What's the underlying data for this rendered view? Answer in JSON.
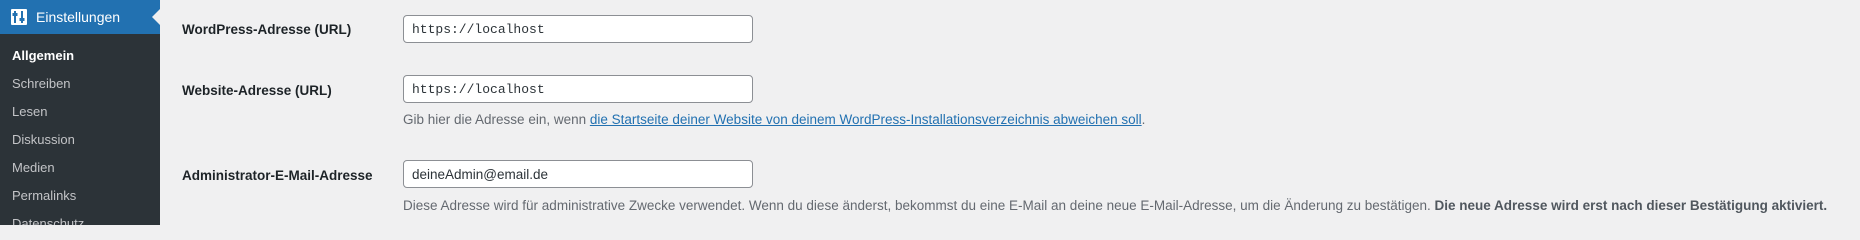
{
  "sidebar": {
    "header": {
      "label": "Einstellungen",
      "icon": "settings-sliders-icon"
    },
    "items": [
      {
        "label": "Allgemein",
        "current": true
      },
      {
        "label": "Schreiben"
      },
      {
        "label": "Lesen"
      },
      {
        "label": "Diskussion"
      },
      {
        "label": "Medien"
      },
      {
        "label": "Permalinks"
      },
      {
        "label": "Datenschutz"
      }
    ]
  },
  "form": {
    "wp_address": {
      "label": "WordPress-Adresse (URL)",
      "value": "https://localhost"
    },
    "site_address": {
      "label": "Website-Adresse (URL)",
      "value": "https://localhost",
      "desc_prefix": "Gib hier die Adresse ein, wenn ",
      "desc_link": "die Startseite deiner Website von deinem WordPress-Installationsverzeichnis abweichen soll",
      "desc_suffix": "."
    },
    "admin_email": {
      "label": "Administrator-E-Mail-Adresse",
      "value": "deineAdmin@email.de",
      "desc_text": "Diese Adresse wird für administrative Zwecke verwendet. Wenn du diese änderst, bekommst du eine E-Mail an deine neue E-Mail-Adresse, um die Änderung zu bestätigen. ",
      "desc_bold": "Die neue Adresse wird erst nach dieser Bestätigung aktiviert."
    }
  },
  "colors": {
    "accent": "#2271b1",
    "sidebar_bg": "#2c3338",
    "page_bg": "#f0f0f1"
  }
}
